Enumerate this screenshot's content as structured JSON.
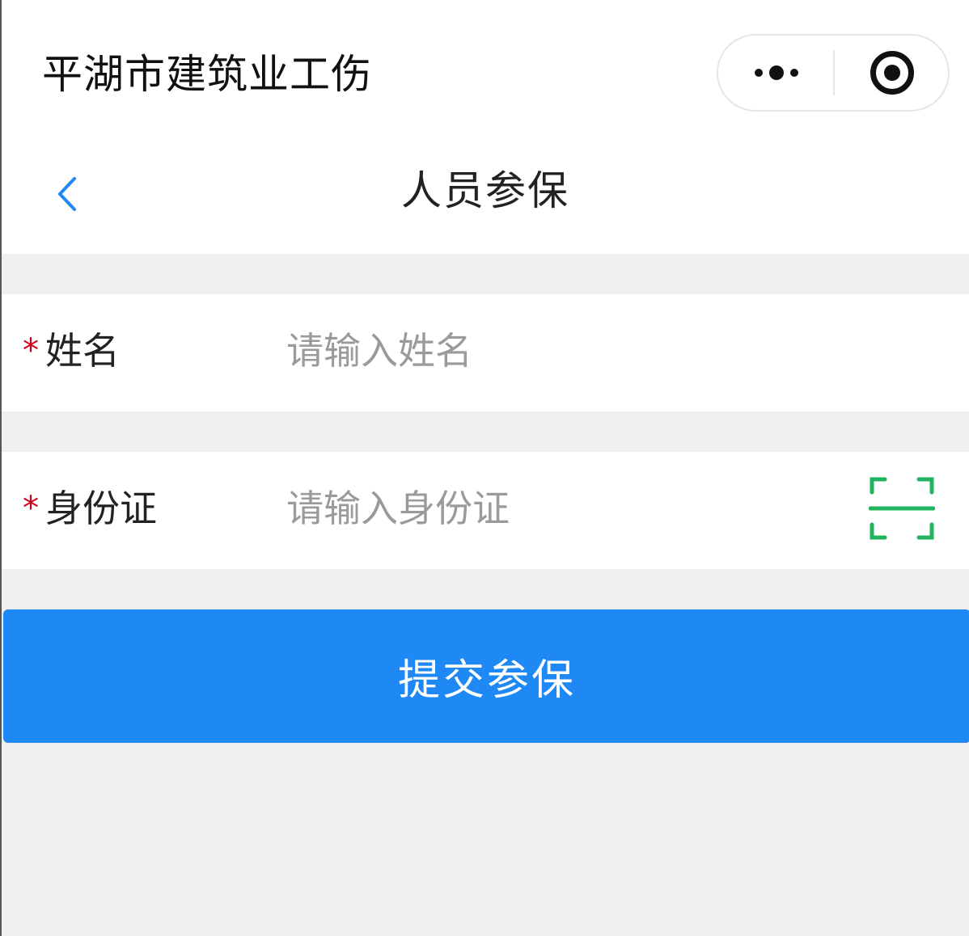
{
  "app": {
    "title": "平湖市建筑业工伤"
  },
  "capsule": {
    "more_icon": "more-dots-icon",
    "close_icon": "target-circle-icon"
  },
  "nav": {
    "back_icon": "chevron-left-icon",
    "title": "人员参保",
    "accent_color": "#1e88f5"
  },
  "form": {
    "required_mark": "*",
    "name": {
      "label": "姓名",
      "value": "",
      "placeholder": "请输入姓名"
    },
    "id_card": {
      "label": "身份证",
      "value": "",
      "placeholder": "请输入身份证",
      "scan_icon": "scan-icon",
      "scan_color": "#22b35e"
    }
  },
  "submit": {
    "label": "提交参保",
    "color": "#1e88f5"
  }
}
